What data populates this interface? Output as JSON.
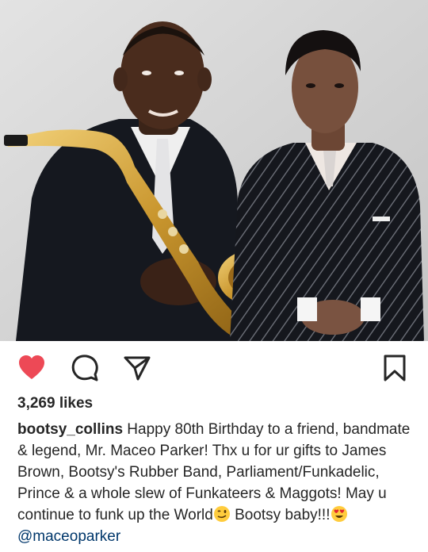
{
  "post": {
    "photo": {
      "people": [
        "Maceo Parker",
        "Prince"
      ],
      "instrument": "saxophone-icon"
    },
    "actions": {
      "like": "heart-icon",
      "comment": "comment-icon",
      "share": "share-icon",
      "save": "bookmark-icon",
      "liked": true,
      "like_color": "#ed4956"
    },
    "likes": {
      "text": "3,269 likes"
    },
    "caption": {
      "username": "bootsy_collins",
      "text_part1": " Happy 80th Birthday to a friend, bandmate & legend, Mr. Maceo Parker! Thx u for ur gifts to James Brown, Bootsy's Rubber Band, Parliament/Funkadelic, Prince & a whole slew of Funkateers & Maggots! May u continue to funk up the World",
      "emoji1": "winking-face-emoji",
      "text_part2": " Bootsy baby!!!",
      "emoji2": "heart-eyes-emoji",
      "text_part3": " ",
      "mention": "@maceoparker",
      "mention_color": "#00376b"
    }
  }
}
